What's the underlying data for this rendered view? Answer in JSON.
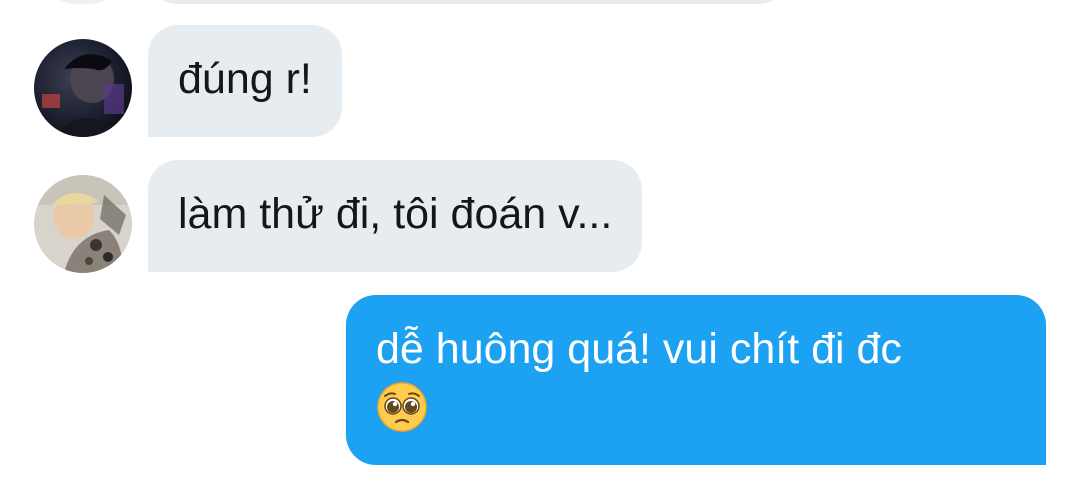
{
  "messages": [
    {
      "direction": "incoming",
      "text": "đúng r!",
      "avatar": "user-avatar-dark-photo"
    },
    {
      "direction": "incoming",
      "text": "làm thử đi, tôi đoán v...",
      "avatar": "user-avatar-light-photo"
    },
    {
      "direction": "outgoing",
      "text": "dễ huông quá! vui chít đi đc",
      "emoji": "pleading-face-emoji"
    }
  ],
  "colors": {
    "incoming_bubble": "#e6ecf0",
    "outgoing_bubble": "#1da1f2",
    "incoming_text": "#14171a",
    "outgoing_text": "#ffffff"
  }
}
